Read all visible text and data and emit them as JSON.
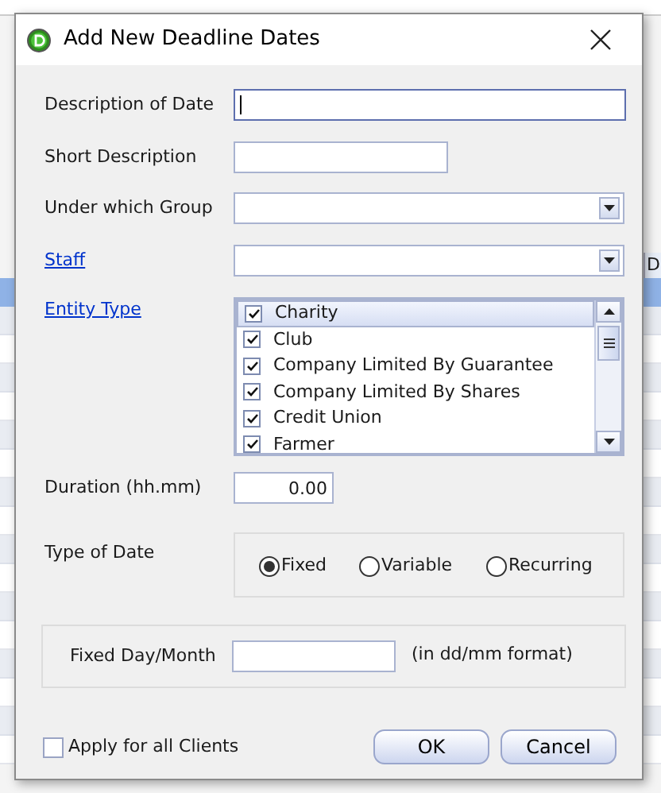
{
  "background": {
    "column_header": "D",
    "rows": [
      {
        "selected": true
      },
      {
        "selected": false
      },
      {
        "selected": false
      },
      {
        "selected": false
      },
      {
        "selected": false
      },
      {
        "selected": false
      },
      {
        "selected": false
      },
      {
        "selected": false
      },
      {
        "selected": false
      },
      {
        "selected": false
      },
      {
        "selected": false
      },
      {
        "selected": false
      },
      {
        "selected": false
      },
      {
        "selected": false
      },
      {
        "selected": false
      },
      {
        "selected": false
      },
      {
        "selected": false
      }
    ]
  },
  "window": {
    "title": "Add New Deadline Dates"
  },
  "fields": [
    {
      "label": "Description of Date",
      "kind": "text",
      "link": false,
      "focused": true
    },
    {
      "label": "Short Description",
      "kind": "short",
      "link": false,
      "focused": false
    },
    {
      "label": "Under which Group",
      "kind": "combo",
      "link": false
    },
    {
      "label": "Staff",
      "kind": "combo",
      "link": true
    },
    {
      "label": "Entity Type",
      "kind": "list",
      "link": true,
      "items": [
        {
          "label": "Charity",
          "checked": true,
          "selected": true
        },
        {
          "label": "Club",
          "checked": true,
          "selected": false
        },
        {
          "label": "Company Limited By Guarantee",
          "checked": true,
          "selected": false
        },
        {
          "label": "Company Limited By Shares",
          "checked": true,
          "selected": false
        },
        {
          "label": "Credit Union",
          "checked": true,
          "selected": false
        },
        {
          "label": "Farmer",
          "checked": true,
          "selected": false
        }
      ]
    },
    {
      "label": "Duration (hh.mm)",
      "kind": "number",
      "link": false,
      "value": "0.00",
      "focused": false
    }
  ],
  "type_of_date": {
    "label": "Type of Date",
    "options": [
      {
        "label": "Fixed",
        "selected": true
      },
      {
        "label": "Variable",
        "selected": false
      },
      {
        "label": "Recurring",
        "selected": false
      }
    ]
  },
  "fixed_day": {
    "label": "Fixed Day/Month",
    "hint": "(in dd/mm format)"
  },
  "apply_all": {
    "label": "Apply for all Clients",
    "checked": false
  },
  "buttons": [
    "OK",
    "Cancel"
  ]
}
